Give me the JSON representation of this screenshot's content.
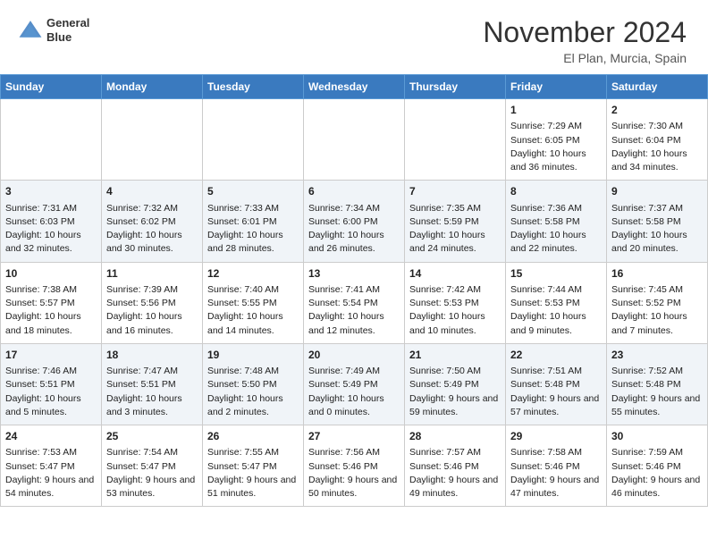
{
  "header": {
    "logo_line1": "General",
    "logo_line2": "Blue",
    "month": "November 2024",
    "location": "El Plan, Murcia, Spain"
  },
  "weekdays": [
    "Sunday",
    "Monday",
    "Tuesday",
    "Wednesday",
    "Thursday",
    "Friday",
    "Saturday"
  ],
  "weeks": [
    [
      {
        "day": "",
        "info": ""
      },
      {
        "day": "",
        "info": ""
      },
      {
        "day": "",
        "info": ""
      },
      {
        "day": "",
        "info": ""
      },
      {
        "day": "",
        "info": ""
      },
      {
        "day": "1",
        "info": "Sunrise: 7:29 AM\nSunset: 6:05 PM\nDaylight: 10 hours and 36 minutes."
      },
      {
        "day": "2",
        "info": "Sunrise: 7:30 AM\nSunset: 6:04 PM\nDaylight: 10 hours and 34 minutes."
      }
    ],
    [
      {
        "day": "3",
        "info": "Sunrise: 7:31 AM\nSunset: 6:03 PM\nDaylight: 10 hours and 32 minutes."
      },
      {
        "day": "4",
        "info": "Sunrise: 7:32 AM\nSunset: 6:02 PM\nDaylight: 10 hours and 30 minutes."
      },
      {
        "day": "5",
        "info": "Sunrise: 7:33 AM\nSunset: 6:01 PM\nDaylight: 10 hours and 28 minutes."
      },
      {
        "day": "6",
        "info": "Sunrise: 7:34 AM\nSunset: 6:00 PM\nDaylight: 10 hours and 26 minutes."
      },
      {
        "day": "7",
        "info": "Sunrise: 7:35 AM\nSunset: 5:59 PM\nDaylight: 10 hours and 24 minutes."
      },
      {
        "day": "8",
        "info": "Sunrise: 7:36 AM\nSunset: 5:58 PM\nDaylight: 10 hours and 22 minutes."
      },
      {
        "day": "9",
        "info": "Sunrise: 7:37 AM\nSunset: 5:58 PM\nDaylight: 10 hours and 20 minutes."
      }
    ],
    [
      {
        "day": "10",
        "info": "Sunrise: 7:38 AM\nSunset: 5:57 PM\nDaylight: 10 hours and 18 minutes."
      },
      {
        "day": "11",
        "info": "Sunrise: 7:39 AM\nSunset: 5:56 PM\nDaylight: 10 hours and 16 minutes."
      },
      {
        "day": "12",
        "info": "Sunrise: 7:40 AM\nSunset: 5:55 PM\nDaylight: 10 hours and 14 minutes."
      },
      {
        "day": "13",
        "info": "Sunrise: 7:41 AM\nSunset: 5:54 PM\nDaylight: 10 hours and 12 minutes."
      },
      {
        "day": "14",
        "info": "Sunrise: 7:42 AM\nSunset: 5:53 PM\nDaylight: 10 hours and 10 minutes."
      },
      {
        "day": "15",
        "info": "Sunrise: 7:44 AM\nSunset: 5:53 PM\nDaylight: 10 hours and 9 minutes."
      },
      {
        "day": "16",
        "info": "Sunrise: 7:45 AM\nSunset: 5:52 PM\nDaylight: 10 hours and 7 minutes."
      }
    ],
    [
      {
        "day": "17",
        "info": "Sunrise: 7:46 AM\nSunset: 5:51 PM\nDaylight: 10 hours and 5 minutes."
      },
      {
        "day": "18",
        "info": "Sunrise: 7:47 AM\nSunset: 5:51 PM\nDaylight: 10 hours and 3 minutes."
      },
      {
        "day": "19",
        "info": "Sunrise: 7:48 AM\nSunset: 5:50 PM\nDaylight: 10 hours and 2 minutes."
      },
      {
        "day": "20",
        "info": "Sunrise: 7:49 AM\nSunset: 5:49 PM\nDaylight: 10 hours and 0 minutes."
      },
      {
        "day": "21",
        "info": "Sunrise: 7:50 AM\nSunset: 5:49 PM\nDaylight: 9 hours and 59 minutes."
      },
      {
        "day": "22",
        "info": "Sunrise: 7:51 AM\nSunset: 5:48 PM\nDaylight: 9 hours and 57 minutes."
      },
      {
        "day": "23",
        "info": "Sunrise: 7:52 AM\nSunset: 5:48 PM\nDaylight: 9 hours and 55 minutes."
      }
    ],
    [
      {
        "day": "24",
        "info": "Sunrise: 7:53 AM\nSunset: 5:47 PM\nDaylight: 9 hours and 54 minutes."
      },
      {
        "day": "25",
        "info": "Sunrise: 7:54 AM\nSunset: 5:47 PM\nDaylight: 9 hours and 53 minutes."
      },
      {
        "day": "26",
        "info": "Sunrise: 7:55 AM\nSunset: 5:47 PM\nDaylight: 9 hours and 51 minutes."
      },
      {
        "day": "27",
        "info": "Sunrise: 7:56 AM\nSunset: 5:46 PM\nDaylight: 9 hours and 50 minutes."
      },
      {
        "day": "28",
        "info": "Sunrise: 7:57 AM\nSunset: 5:46 PM\nDaylight: 9 hours and 49 minutes."
      },
      {
        "day": "29",
        "info": "Sunrise: 7:58 AM\nSunset: 5:46 PM\nDaylight: 9 hours and 47 minutes."
      },
      {
        "day": "30",
        "info": "Sunrise: 7:59 AM\nSunset: 5:46 PM\nDaylight: 9 hours and 46 minutes."
      }
    ]
  ]
}
